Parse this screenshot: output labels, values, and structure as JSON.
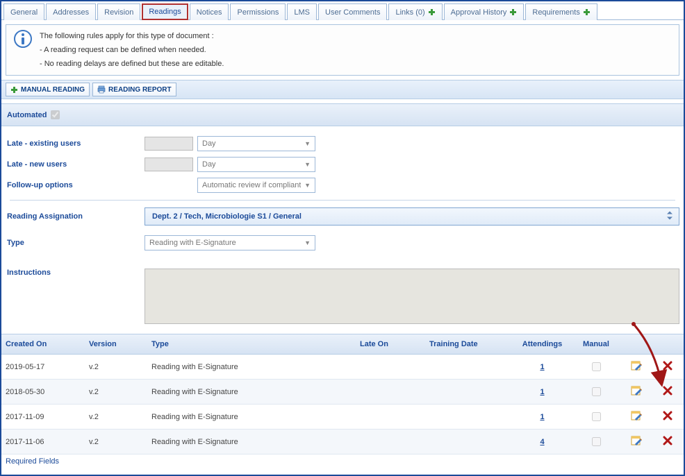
{
  "tabs": [
    {
      "label": "General",
      "plus": false
    },
    {
      "label": "Addresses",
      "plus": false
    },
    {
      "label": "Revision",
      "plus": false
    },
    {
      "label": "Readings",
      "plus": false,
      "active": true
    },
    {
      "label": "Notices",
      "plus": false
    },
    {
      "label": "Permissions",
      "plus": false
    },
    {
      "label": "LMS",
      "plus": false
    },
    {
      "label": "User Comments",
      "plus": false
    },
    {
      "label": "Links (0)",
      "plus": true
    },
    {
      "label": "Approval History",
      "plus": true
    },
    {
      "label": "Requirements",
      "plus": true
    }
  ],
  "info": {
    "line1": "The following rules apply for this type of document :",
    "line2": "- A reading request can be defined when needed.",
    "line3": "- No reading delays are defined but these are editable."
  },
  "toolbar": {
    "manual_reading": "MANUAL READING",
    "reading_report": "READING REPORT"
  },
  "automated": {
    "label": "Automated",
    "checked": true
  },
  "form": {
    "late_existing_label": "Late - existing users",
    "late_existing_unit": "Day",
    "late_new_label": "Late - new users",
    "late_new_unit": "Day",
    "followup_label": "Follow-up options",
    "followup_value": "Automatic review if compliant",
    "assignation_label": "Reading Assignation",
    "assignation_value": "Dept. 2 / Tech, Microbiologie S1 / General",
    "type_label": "Type",
    "type_value": "Reading with E-Signature",
    "instructions_label": "Instructions"
  },
  "table": {
    "headers": {
      "created": "Created On",
      "version": "Version",
      "type": "Type",
      "late": "Late On",
      "training": "Training Date",
      "attendings": "Attendings",
      "manual": "Manual"
    },
    "rows": [
      {
        "created": "2019-05-17",
        "version": "v.2",
        "type": "Reading with E-Signature",
        "late": "",
        "training": "",
        "attendings": "1",
        "manual": false
      },
      {
        "created": "2018-05-30",
        "version": "v.2",
        "type": "Reading with E-Signature",
        "late": "",
        "training": "",
        "attendings": "1",
        "manual": false
      },
      {
        "created": "2017-11-09",
        "version": "v.2",
        "type": "Reading with E-Signature",
        "late": "",
        "training": "",
        "attendings": "1",
        "manual": false
      },
      {
        "created": "2017-11-06",
        "version": "v.2",
        "type": "Reading with E-Signature",
        "late": "",
        "training": "",
        "attendings": "4",
        "manual": false
      }
    ]
  },
  "footer": {
    "required": "Required Fields"
  }
}
